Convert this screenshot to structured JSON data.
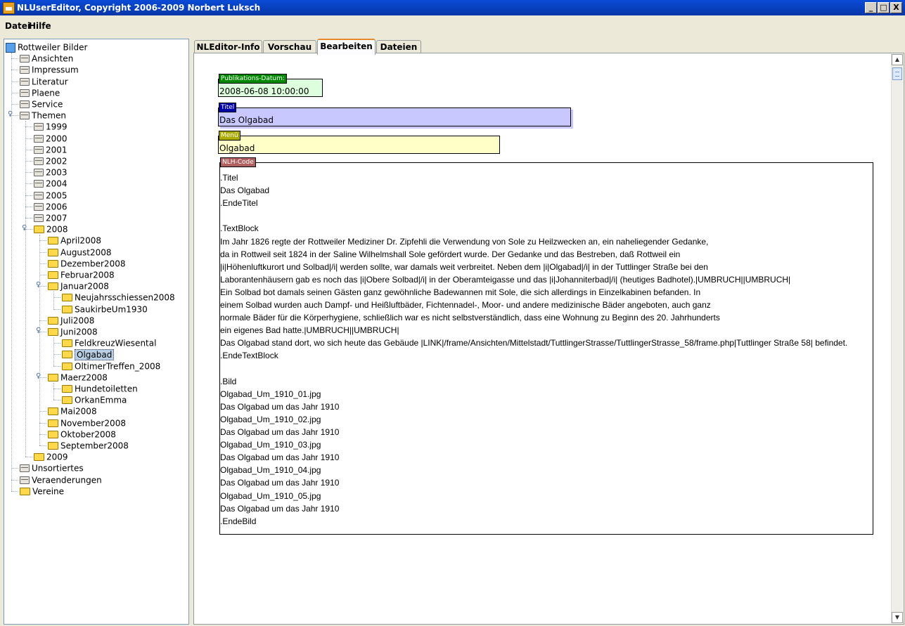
{
  "window": {
    "title": "NLUserEditor,  Copyright 2006-2009 Norbert Luksch",
    "buttons": [
      "_",
      "□",
      "X"
    ]
  },
  "menu": [
    "Datei",
    "Hilfe"
  ],
  "tree": [
    {
      "label": "Rottweiler Bilder",
      "icon": "root-icon",
      "level": 0
    },
    {
      "label": "Ansichten",
      "icon": "folder-closed",
      "level": 1
    },
    {
      "label": "Impressum",
      "icon": "folder-closed",
      "level": 1
    },
    {
      "label": "Literatur",
      "icon": "folder-closed",
      "level": 1
    },
    {
      "label": "Plaene",
      "icon": "folder-closed",
      "level": 1
    },
    {
      "label": "Service",
      "icon": "folder-closed",
      "level": 1
    },
    {
      "label": "Themen",
      "icon": "folder-closed",
      "level": 1,
      "expanded": true
    },
    {
      "label": "1999",
      "icon": "folder-closed",
      "level": 2
    },
    {
      "label": "2000",
      "icon": "folder-closed",
      "level": 2
    },
    {
      "label": "2001",
      "icon": "folder-closed",
      "level": 2
    },
    {
      "label": "2002",
      "icon": "folder-closed",
      "level": 2
    },
    {
      "label": "2003",
      "icon": "folder-closed",
      "level": 2
    },
    {
      "label": "2004",
      "icon": "folder-closed",
      "level": 2
    },
    {
      "label": "2005",
      "icon": "folder-closed",
      "level": 2
    },
    {
      "label": "2006",
      "icon": "folder-closed",
      "level": 2
    },
    {
      "label": "2007",
      "icon": "folder-closed",
      "level": 2
    },
    {
      "label": "2008",
      "icon": "folder-yellow",
      "level": 2,
      "expanded": true
    },
    {
      "label": "April2008",
      "icon": "folder-yellow",
      "level": 3
    },
    {
      "label": "August2008",
      "icon": "folder-yellow",
      "level": 3
    },
    {
      "label": "Dezember2008",
      "icon": "folder-yellow",
      "level": 3
    },
    {
      "label": "Februar2008",
      "icon": "folder-yellow",
      "level": 3
    },
    {
      "label": "Januar2008",
      "icon": "folder-yellow",
      "level": 3,
      "expanded": true
    },
    {
      "label": "Neujahrsschiessen2008",
      "icon": "folder-yellow",
      "level": 4
    },
    {
      "label": "SaukirbeUm1930",
      "icon": "folder-yellow",
      "level": 4
    },
    {
      "label": "Juli2008",
      "icon": "folder-yellow",
      "level": 3
    },
    {
      "label": "Juni2008",
      "icon": "folder-yellow",
      "level": 3,
      "expanded": true
    },
    {
      "label": "FeldkreuzWiesental",
      "icon": "folder-yellow",
      "level": 4
    },
    {
      "label": "Olgabad",
      "icon": "folder-yellow",
      "level": 4,
      "selected": true
    },
    {
      "label": "OltimerTreffen_2008",
      "icon": "folder-yellow",
      "level": 4
    },
    {
      "label": "Maerz2008",
      "icon": "folder-yellow",
      "level": 3,
      "expanded": true
    },
    {
      "label": "Hundetoiletten",
      "icon": "folder-yellow",
      "level": 4
    },
    {
      "label": "OrkanEmma",
      "icon": "folder-yellow",
      "level": 4
    },
    {
      "label": "Mai2008",
      "icon": "folder-yellow",
      "level": 3
    },
    {
      "label": "November2008",
      "icon": "folder-yellow",
      "level": 3
    },
    {
      "label": "Oktober2008",
      "icon": "folder-yellow",
      "level": 3
    },
    {
      "label": "September2008",
      "icon": "folder-yellow",
      "level": 3
    },
    {
      "label": "2009",
      "icon": "folder-yellow",
      "level": 2
    },
    {
      "label": "Unsortiertes",
      "icon": "folder-closed",
      "level": 1
    },
    {
      "label": "Veraenderungen",
      "icon": "folder-closed",
      "level": 1
    },
    {
      "label": "Vereine",
      "icon": "folder-yellow",
      "level": 1
    }
  ],
  "tabs": [
    {
      "label": "NLEditor-Info",
      "active": false
    },
    {
      "label": "Vorschau",
      "active": false
    },
    {
      "label": "Bearbeiten",
      "active": true
    },
    {
      "label": "Dateien",
      "active": false
    }
  ],
  "fields": {
    "date": {
      "label": "Publikations-Datum:",
      "value": "2008-06-08 10:00:00",
      "color": "#ddffdd",
      "label_color": "#008800"
    },
    "title": {
      "label": "Titel",
      "value": "Das Olgabad",
      "color": "#c8c8ff",
      "label_color": "#0000aa"
    },
    "menu": {
      "label": "Menü",
      "value": "Olgabad",
      "color": "#ffffc8",
      "label_color": "#aaaa00"
    },
    "code": {
      "label": "NLH-Code",
      "label_color": "#b06060"
    }
  },
  "code_lines": [
    ".Titel",
    "Das Olgabad",
    ".EndeTitel",
    "",
    ".TextBlock",
    "Im Jahr 1826 regte der Rottweiler Mediziner Dr. Zipfehli die Verwendung von Sole zu Heilzwecken an, ein naheliegender Gedanke,",
    "da in Rottweil seit 1824 in der Saline Wilhelmshall Sole gefördert wurde. Der Gedanke und das Bestreben, daß Rottweil ein",
    "|i|Höhenluftkurort und Solbad|/i| werden sollte, war damals weit verbreitet. Neben dem |i|Olgabad|/i| in der Tuttlinger Straße bei den",
    "Laborantenhäusern gab es noch das |i|Obere Solbad|/i| in der Oberamteigasse und das |i|Johanniterbad|/i| (heutiges Badhotel).|UMBRUCH||UMBRUCH|",
    "Ein Solbad bot damals seinen Gästen ganz gewöhnliche Badewannen mit Sole, die sich allerdings in Einzelkabinen befanden. In",
    "einem Solbad wurden auch Dampf- und Heißluftbäder, Fichtennadel-, Moor- und andere medizinische Bäder angeboten, auch ganz",
    "normale Bäder für die Körperhygiene, schließlich war es nicht selbstverständlich, dass eine Wohnung zu Beginn des 20. Jahrhunderts",
    "ein eigenes Bad hatte.|UMBRUCH||UMBRUCH|",
    "Das Olgabad stand dort, wo sich heute das Gebäude |LINK|/frame/Ansichten/Mittelstadt/TuttlingerStrasse/TuttlingerStrasse_58/frame.php|Tuttlinger Straße 58| befindet.",
    ".EndeTextBlock",
    "",
    ".Bild",
    "Olgabad_Um_1910_01.jpg",
    "Das Olgabad um das Jahr 1910",
    "Olgabad_Um_1910_02.jpg",
    "Das Olgabad um das Jahr 1910",
    "Olgabad_Um_1910_03.jpg",
    "Das Olgabad um das Jahr 1910",
    "Olgabad_Um_1910_04.jpg",
    "Das Olgabad um das Jahr 1910",
    "Olgabad_Um_1910_05.jpg",
    "Das Olgabad um das Jahr 1910",
    ".EndeBild"
  ]
}
